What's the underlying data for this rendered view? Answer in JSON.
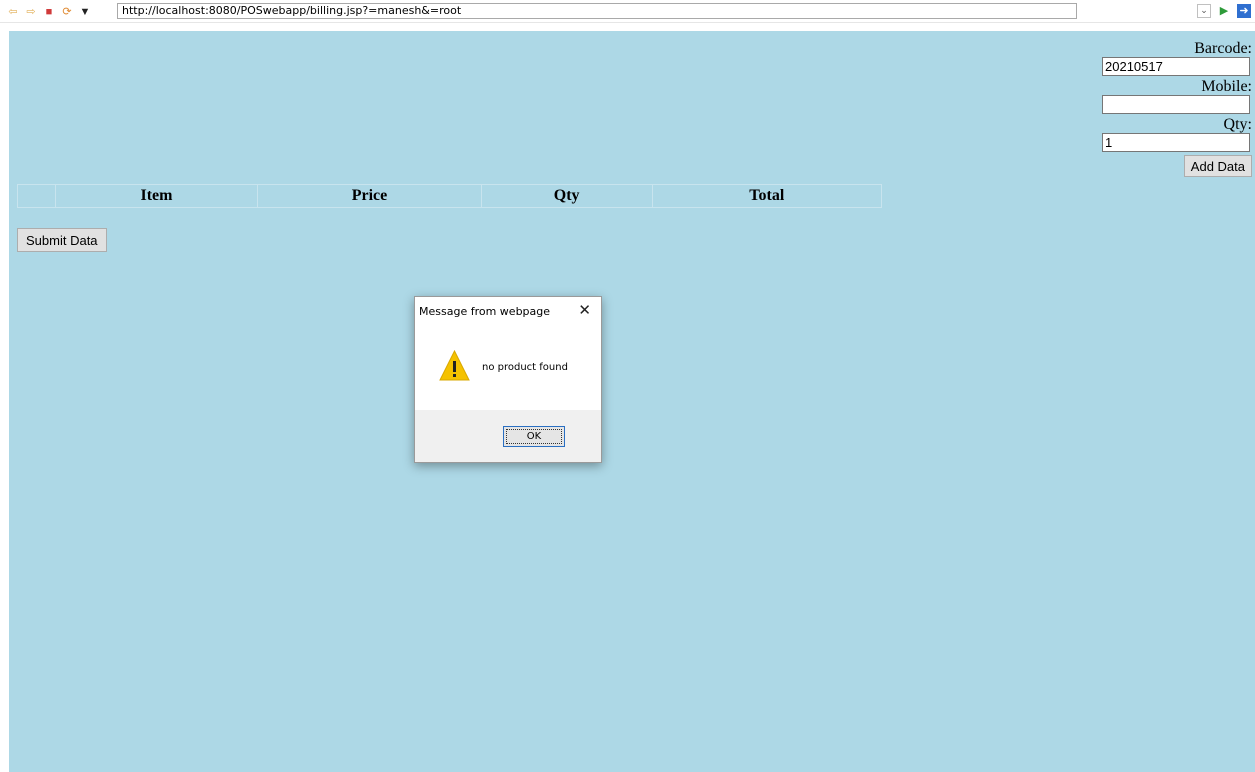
{
  "browser": {
    "url": "http://localhost:8080/POSwebapp/billing.jsp?=manesh&=root",
    "icons": [
      "back-icon",
      "forward-icon",
      "stop-icon",
      "refresh-icon",
      "dropdown-icon",
      "url-dropdown-icon",
      "go-icon",
      "exit-icon"
    ]
  },
  "form": {
    "barcode_label": "Barcode:",
    "barcode_value": "20210517",
    "mobile_label": "Mobile:",
    "mobile_value": "",
    "qty_label": "Qty:",
    "qty_value": "1",
    "add_button": "Add Data"
  },
  "table": {
    "columns": [
      "",
      "Item",
      "Price",
      "Qty",
      "Total"
    ]
  },
  "submit_button": "Submit Data",
  "dialog": {
    "title": "Message from webpage",
    "message": "no product found",
    "ok_button": "OK"
  },
  "colors": {
    "page_background": "#add8e6",
    "dialog_accent": "#2a6fc2",
    "warning_yellow": "#f5c200"
  }
}
